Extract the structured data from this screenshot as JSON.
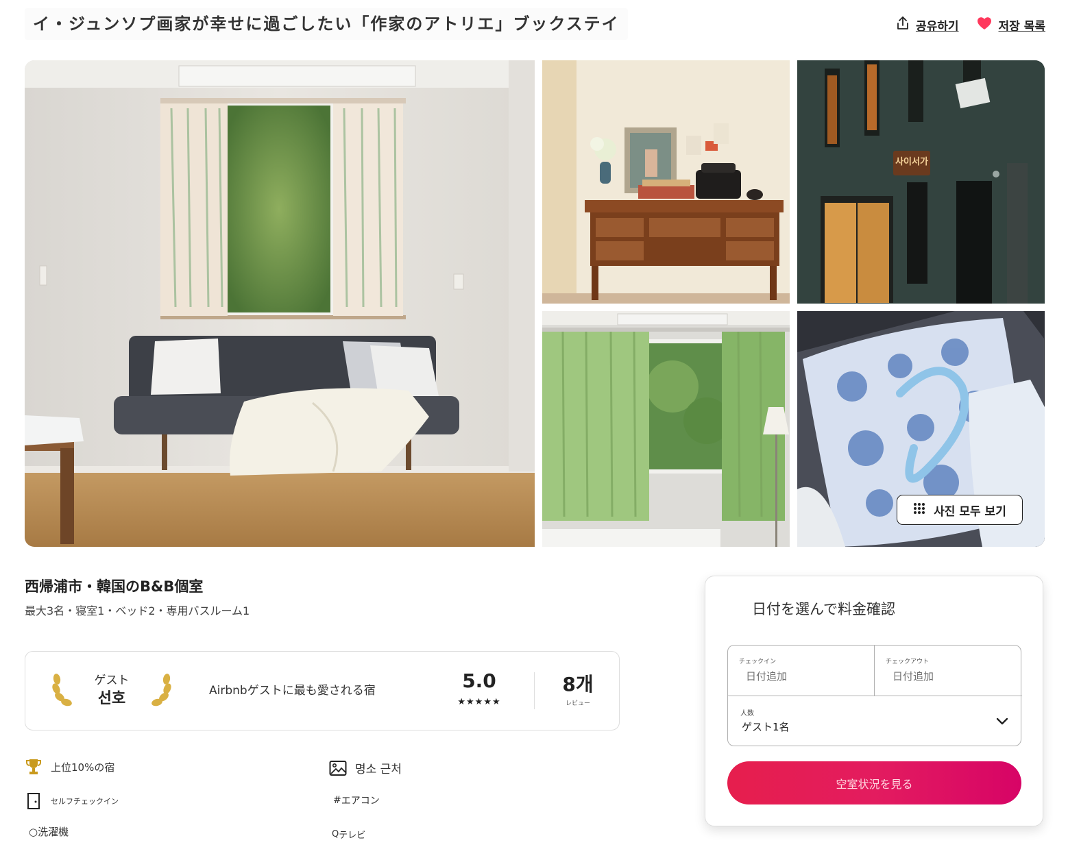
{
  "listing": {
    "title": "イ・ジュンソプ画家が幸せに過ごしたい「作家のアトリエ」ブックステイ",
    "subtitle": "西帰浦市・韓国のB&B個室",
    "details": "最大3名・寝室1・ベッド2・専用バスルーム1"
  },
  "header": {
    "share_label": "공유하기",
    "share_icon": "share-icon",
    "save_label": "저장 목록",
    "save_icon": "heart-icon",
    "heart_color": "#ff385c"
  },
  "gallery": {
    "show_all_label": "사진 모두 보기",
    "building_sign": "사이서가"
  },
  "guest_favorite": {
    "badge_top": "ゲスト",
    "badge_bottom": "선호",
    "description": "Airbnbゲストに最も愛される宿",
    "rating": "5.0",
    "stars": "★★★★★",
    "reviews_count": "8개",
    "reviews_label": "レビュー"
  },
  "amenities": {
    "left": [
      {
        "icon": "trophy-icon",
        "label": "上位10%の宿"
      },
      {
        "icon": "door-icon",
        "label": "セルフチェックイン"
      },
      {
        "icon": "circle-icon",
        "label": "洗濯機"
      }
    ],
    "right": [
      {
        "icon": "image-icon",
        "label": "명소 근처"
      },
      {
        "icon": "hash-icon",
        "label": "エアコン"
      },
      {
        "icon": "tv-icon",
        "label": "テレビ"
      }
    ],
    "left_glyphs": {
      "circle": "○"
    },
    "right_glyphs": {
      "hash": "#",
      "tv": "Q"
    }
  },
  "booking": {
    "title": "日付を選んで料金確認",
    "checkin_label": "チェックイン",
    "checkin_value": "日付追加",
    "checkout_label": "チェックアウト",
    "checkout_value": "日付追加",
    "guests_label": "人数",
    "guests_value": "ゲスト1名",
    "reserve_label": "空室状況を見る",
    "accent_color": "#e31c5f"
  }
}
